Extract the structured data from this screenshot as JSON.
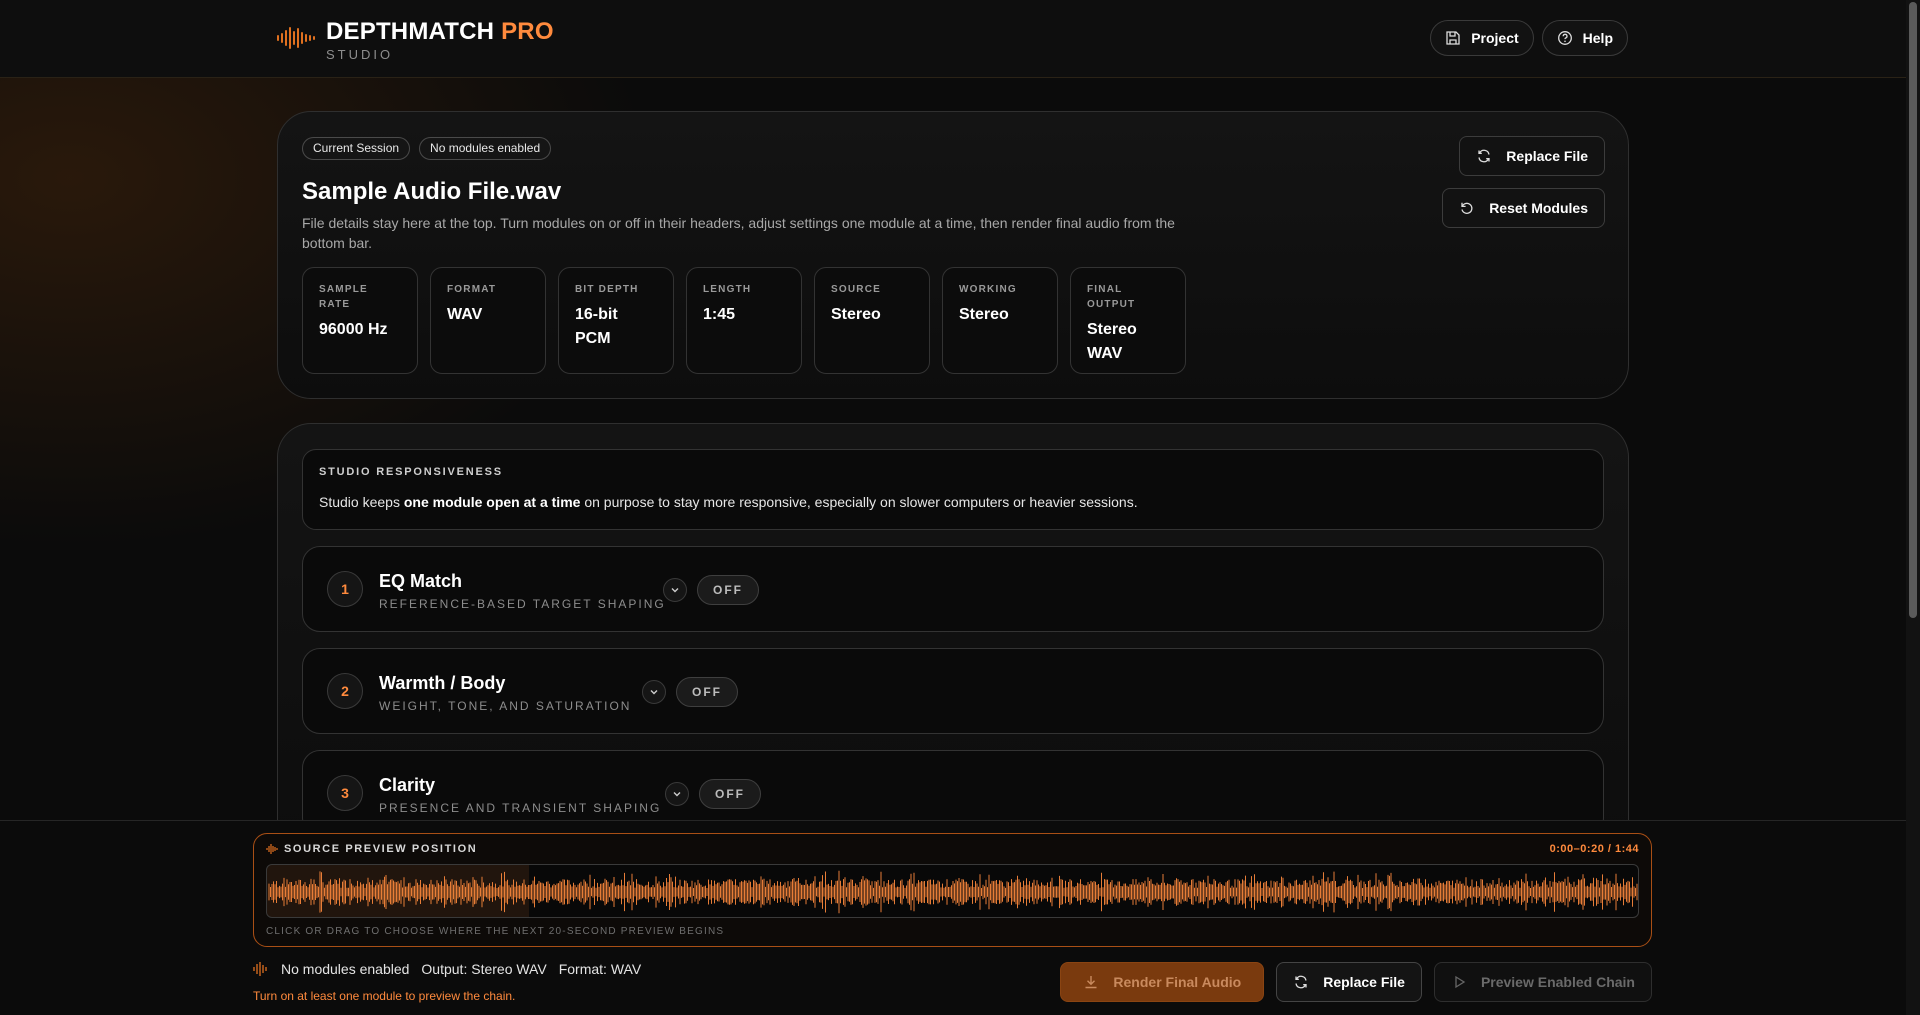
{
  "app": {
    "brand_name": "DEPTHMATCH",
    "brand_pro": "PRO",
    "brand_sub": "STUDIO",
    "accent_color": "#ff8a3d"
  },
  "header": {
    "project_label": "Project",
    "help_label": "Help"
  },
  "session": {
    "badges": [
      "Current Session",
      "No modules enabled"
    ],
    "file_name": "Sample Audio File.wav",
    "description": "File details stay here at the top. Turn modules on or off in their headers, adjust settings one module at a time, then render final audio from the bottom bar.",
    "stats": [
      {
        "label": "SAMPLE RATE",
        "value": "96000 Hz"
      },
      {
        "label": "FORMAT",
        "value": "WAV"
      },
      {
        "label": "BIT DEPTH",
        "value": "16-bit PCM"
      },
      {
        "label": "LENGTH",
        "value": "1:45"
      },
      {
        "label": "SOURCE",
        "value": "Stereo"
      },
      {
        "label": "WORKING",
        "value": "Stereo"
      },
      {
        "label": "FINAL OUTPUT",
        "value": "Stereo WAV"
      }
    ],
    "replace_file_label": "Replace File",
    "reset_modules_label": "Reset Modules"
  },
  "responsiveness": {
    "heading": "STUDIO RESPONSIVENESS",
    "text_before": "Studio keeps ",
    "text_bold": "one module open at a time",
    "text_after": " on purpose to stay more responsive, especially on slower computers or heavier sessions."
  },
  "modules": [
    {
      "number": "1",
      "title": "EQ Match",
      "subtitle": "REFERENCE-BASED TARGET SHAPING",
      "state": "OFF"
    },
    {
      "number": "2",
      "title": "Warmth / Body",
      "subtitle": "WEIGHT, TONE, AND SATURATION",
      "state": "OFF"
    },
    {
      "number": "3",
      "title": "Clarity",
      "subtitle": "PRESENCE AND TRANSIENT SHAPING",
      "state": "OFF"
    }
  ],
  "preview": {
    "heading": "SOURCE PREVIEW POSITION",
    "range": "0:00–0:20 / 1:44",
    "hint": "CLICK OR DRAG TO CHOOSE WHERE THE NEXT 20-SECOND PREVIEW BEGINS"
  },
  "status": {
    "modules": "No modules enabled",
    "output": "Output: Stereo WAV",
    "format": "Format: WAV",
    "warning": "Turn on at least one module to preview the chain."
  },
  "actions": {
    "render_label": "Render Final Audio",
    "replace_label": "Replace File",
    "preview_label": "Preview Enabled Chain"
  }
}
